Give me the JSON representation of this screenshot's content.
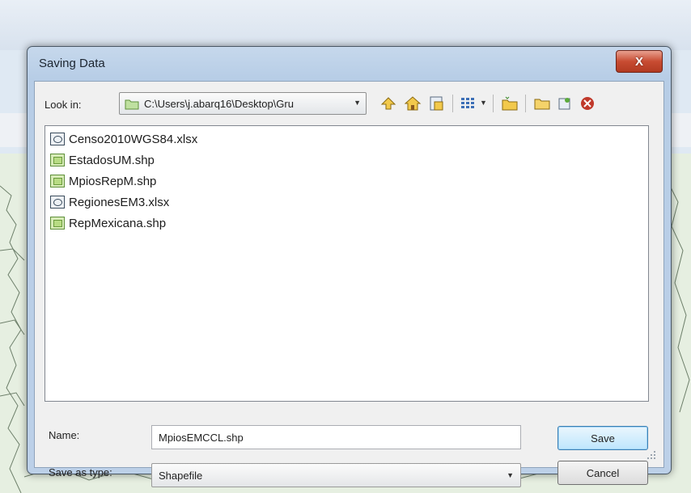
{
  "window": {
    "title": "Saving Data",
    "close_label": "X"
  },
  "look_in": {
    "label": "Look in:",
    "path": "C:\\Users\\j.abarq16\\Desktop\\Gru"
  },
  "toolbar": {
    "icons": [
      "up-one-level-icon",
      "home-icon",
      "connect-folder-icon",
      "view-menu-icon",
      "view-dropdown-icon",
      "new-folder-icon",
      "folder-icon",
      "refresh-icon",
      "delete-icon"
    ]
  },
  "files": [
    {
      "name": "Censo2010WGS84.xlsx",
      "type": "xlsx"
    },
    {
      "name": "EstadosUM.shp",
      "type": "shp"
    },
    {
      "name": "MpiosRepM.shp",
      "type": "shp"
    },
    {
      "name": "RegionesEM3.xlsx",
      "type": "xlsx"
    },
    {
      "name": "RepMexicana.shp",
      "type": "shp"
    }
  ],
  "form": {
    "name_label": "Name:",
    "name_value": "MpiosEMCCL.shp",
    "type_label": "Save as type:",
    "type_value": "Shapefile"
  },
  "buttons": {
    "save": "Save",
    "cancel": "Cancel"
  },
  "colors": {
    "close_button": "#c84c32",
    "shapefile_icon": "#b8dc84",
    "save_button_border": "#3c7fb1"
  }
}
